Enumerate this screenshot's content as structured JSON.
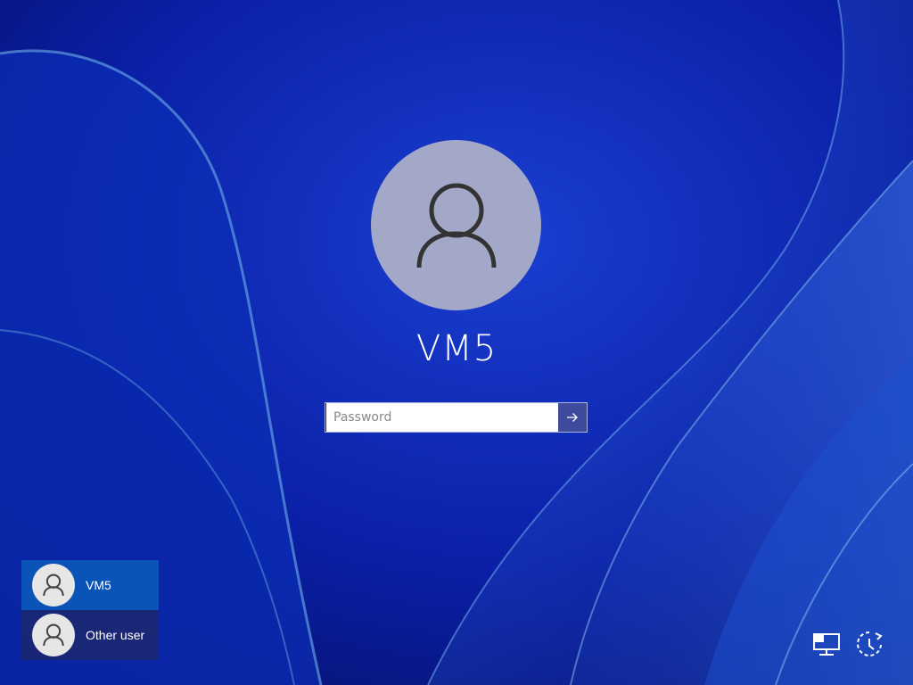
{
  "login": {
    "account_name": "VM5",
    "password_placeholder": "Password"
  },
  "user_list": [
    {
      "label": "VM5",
      "selected": true
    },
    {
      "label": "Other user",
      "selected": false
    }
  ],
  "icons": {
    "submit": "arrow-right-icon",
    "user": "user-icon",
    "network": "network-icon",
    "ease_of_access": "accessibility-icon"
  },
  "colors": {
    "background": "#0a1a8a",
    "avatar": "#a3a8c9",
    "selected_tile": "#0a54b8"
  }
}
